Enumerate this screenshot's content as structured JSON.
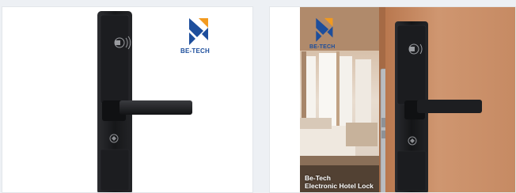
{
  "products": [
    {
      "brand_logo": {
        "text": "BE-TECH",
        "icon": "be-tech-logo-icon"
      },
      "image": "black-electronic-hotel-door-lock"
    },
    {
      "brand_logo": {
        "text": "BE-TECH",
        "icon": "be-tech-logo-icon"
      },
      "caption_line1": "Be-Tech",
      "caption_line2": "Electronic Hotel Lock",
      "image": "electronic-hotel-lock-on-wooden-door"
    }
  ],
  "colors": {
    "logo_blue": "#1d4e9c",
    "logo_orange": "#f29a1f",
    "lock_body": "#1a1b1e",
    "door_wood": "#c98e66"
  }
}
